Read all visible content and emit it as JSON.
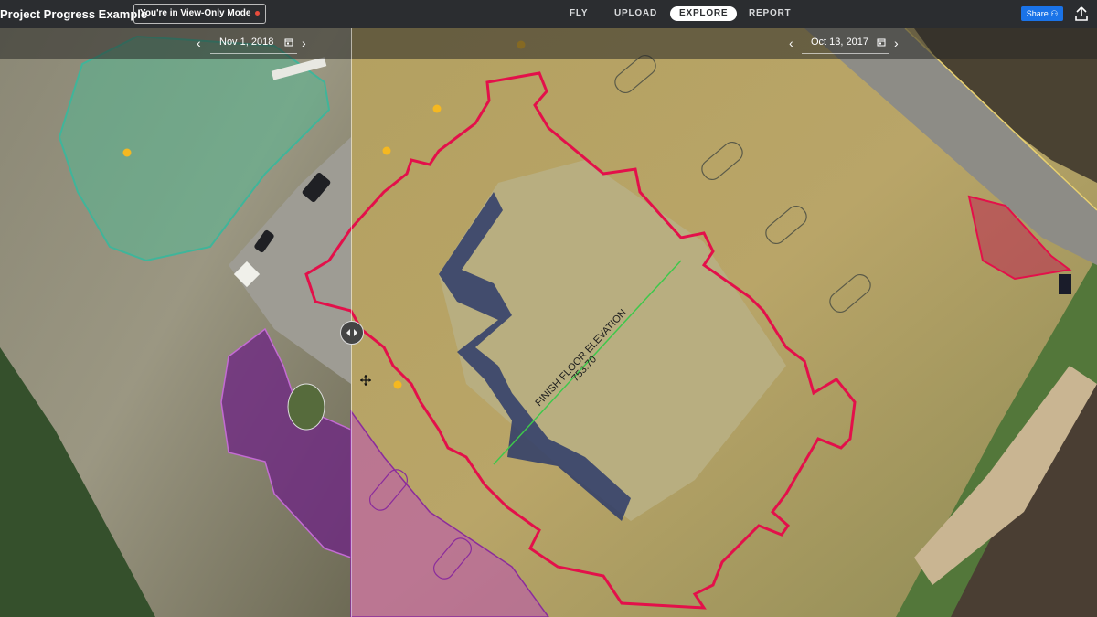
{
  "header": {
    "project_title": "Project Progress Example",
    "view_only_label": "You're in View-Only Mode",
    "tabs": [
      {
        "label": "FLY",
        "active": false
      },
      {
        "label": "UPLOAD",
        "active": false
      },
      {
        "label": "EXPLORE",
        "active": true
      },
      {
        "label": "REPORT",
        "active": false
      }
    ],
    "share_label": "Share",
    "upload_icon": "upload-icon"
  },
  "compare": {
    "left_date": "Nov 1, 2018",
    "right_date": "Oct 13, 2017"
  },
  "map": {
    "annotation_line1": "FINISH FLOOR ELEVATION",
    "annotation_line2": "753.70",
    "colors": {
      "boundary": "#e3104a",
      "paving": "#8b2c9c",
      "pond": "#3fb59a",
      "marker": "#f5b820"
    }
  }
}
